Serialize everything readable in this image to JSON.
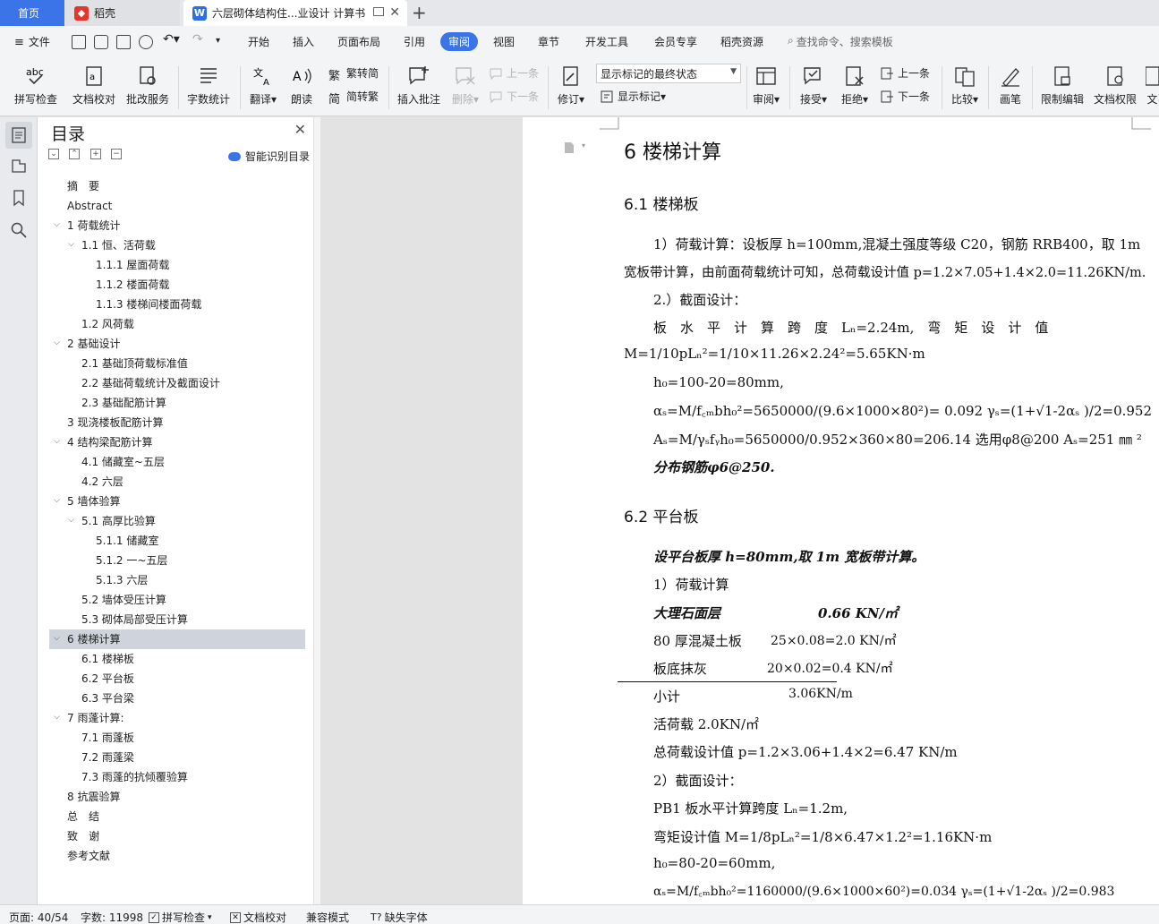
{
  "tabs": {
    "home": "首页",
    "daoke": "稻壳",
    "doc": "六层砌体结构住...业设计 计算书",
    "add": "+"
  },
  "menu": {
    "file": "文件",
    "items": [
      "开始",
      "插入",
      "页面布局",
      "引用",
      "审阅",
      "视图",
      "章节",
      "开发工具",
      "会员专享",
      "稻壳资源"
    ],
    "search": "查找命令、搜索模板"
  },
  "ribbon": {
    "spell": "拼写检查",
    "proof": "文档校对",
    "correct": "批改服务",
    "wordcount": "字数统计",
    "translate": "翻译",
    "read": "朗读",
    "t2s": "繁转简",
    "s2t": "简转繁",
    "insert_comment": "插入批注",
    "delete": "删除",
    "prev1": "上一条",
    "next1": "下一条",
    "revise": "修订",
    "display_state": "显示标记的最终状态",
    "show_markup": "显示标记",
    "review": "审阅",
    "accept": "接受",
    "reject": "拒绝",
    "prev2": "上一条",
    "next2": "下一条",
    "compare": "比较",
    "pen": "画笔",
    "restrict": "限制编辑",
    "perm": "文档权限",
    "more": "文"
  },
  "toc": {
    "title": "目录",
    "smart": "智能识别目录",
    "items": [
      {
        "text": "摘　要"
      },
      {
        "text": "Abstract"
      },
      {
        "text": "1  荷载统计"
      },
      {
        "text": "1.1 恒、活荷载"
      },
      {
        "text": "1.1.1 屋面荷载"
      },
      {
        "text": "1.1.2  楼面荷载"
      },
      {
        "text": "1.1.3  楼梯间楼面荷载"
      },
      {
        "text": "1.2  风荷载"
      },
      {
        "text": "2  基础设计"
      },
      {
        "text": "2.1  基础顶荷载标准值"
      },
      {
        "text": "2.2  基础荷载统计及截面设计"
      },
      {
        "text": "2.3  基础配筋计算"
      },
      {
        "text": "3  现浇楼板配筋计算"
      },
      {
        "text": "4  结构梁配筋计算"
      },
      {
        "text": "4.1  储藏室~五层"
      },
      {
        "text": "4.2  六层"
      },
      {
        "text": "5  墙体验算"
      },
      {
        "text": "5.1  高厚比验算"
      },
      {
        "text": "5.1.1 储藏室"
      },
      {
        "text": "5.1.2  一~五层"
      },
      {
        "text": "5.1.3  六层"
      },
      {
        "text": "5.2  墙体受压计算"
      },
      {
        "text": "5.3  砌体局部受压计算"
      },
      {
        "text": "6  楼梯计算"
      },
      {
        "text": "6.1  楼梯板"
      },
      {
        "text": "6.2  平台板"
      },
      {
        "text": "6.3  平台梁"
      },
      {
        "text": "7  雨蓬计算:"
      },
      {
        "text": "7.1  雨蓬板"
      },
      {
        "text": "7.2  雨蓬梁"
      },
      {
        "text": "7.3  雨蓬的抗倾覆验算"
      },
      {
        "text": "8  抗震验算"
      },
      {
        "text": "总　结"
      },
      {
        "text": "致　谢"
      },
      {
        "text": "参考文献"
      }
    ]
  },
  "doc": {
    "h1": "6  楼梯计算",
    "h61": "6.1  楼梯板",
    "p1a": "1）荷载计算：设板厚 h=100mm,混凝土强度等级 C20，钢筋 RRB400，取 1m",
    "p1b": "宽板带计算，由前面荷载统计可知，总荷载设计值  p=1.2×7.05+1.4×2.0=11.26KN/m.",
    "p2": "2.）截面设计：",
    "p3a": "板　水　平　计　算　跨　度　Lₙ=2.24m,　弯　矩　设　计　值",
    "p3b": "M=1/10pLₙ²=1/10×11.26×2.24²=5.65KN·m",
    "p4": "h₀=100-20=80mm,",
    "p5": "αₛ=M/f꜀ₘbh₀²=5650000/(9.6×1000×80²)= 0.092       γₛ=(1+√1-2αₛ )/2=0.952",
    "p6": "Aₛ=M/γₛfᵧh₀=5650000/0.952×360×80=206.14  选用φ8@200     Aₛ=251 ㎜ ²",
    "p7": "分布钢筋φ6@250.",
    "h62": "6.2  平台板",
    "q1": "设平台板厚 h=80mm,取 1m 宽板带计算。",
    "q2": "1）荷载计算",
    "q3a": "大理石面层",
    "q3b": "0.66 KN/㎡",
    "q4a": "80 厚混凝土板",
    "q4b": "25×0.08=2.0 KN/㎡",
    "q5a": "板底抹灰",
    "q5b": "20×0.02=0.4 KN/㎡",
    "q6a": "小计",
    "q6b": "3.06KN/m",
    "q7": "活荷载 2.0KN/㎡",
    "q8": "总荷载设计值 p=1.2×3.06+1.4×2=6.47 KN/m",
    "q9": "2）截面设计：",
    "q10": "PB1 板水平计算跨度 Lₙ=1.2m,",
    "q11": "弯矩设计值   M=1/8pLₙ²=1/8×6.47×1.2²=1.16KN·m",
    "q12": "h₀=80-20=60mm,",
    "q13": "αₛ=M/f꜀ₘbh₀²=1160000/(9.6×1000×60²)=0.034     γₛ=(1+√1-2αₛ )/2=0.983"
  },
  "status": {
    "page": "页面: 40/54",
    "words": "字数: 11998",
    "spell": "拼写检查",
    "proof": "文档校对",
    "compat": "兼容模式",
    "font": "缺失字体"
  },
  "colors": {
    "accent": "#3b74e8",
    "daoke_red": "#e8342b",
    "selection": "#cfd4dc"
  }
}
